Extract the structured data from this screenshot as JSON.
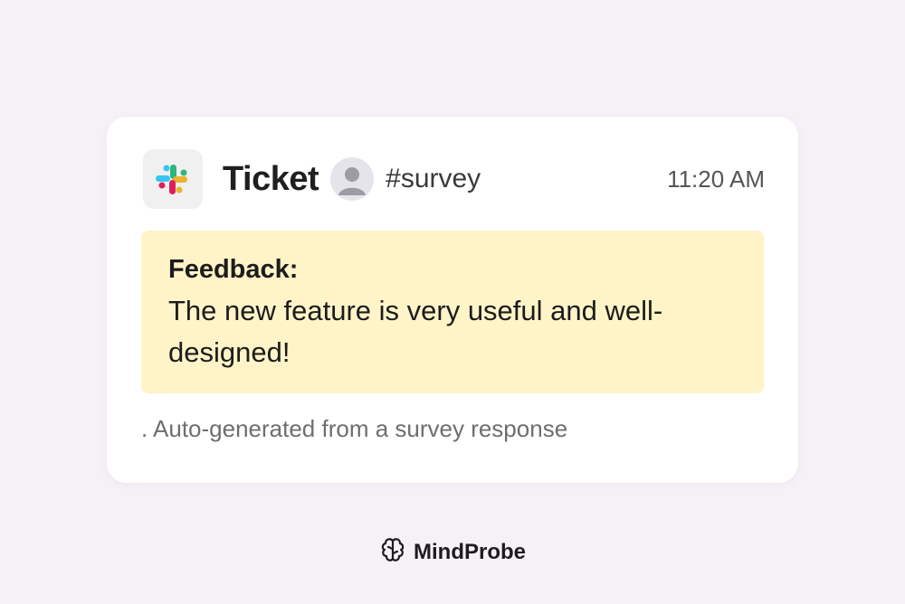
{
  "card": {
    "app_icon": "slack-logo-icon",
    "title": "Ticket",
    "avatar_icon": "user-avatar-icon",
    "channel": "#survey",
    "time": "11:20 AM",
    "feedback": {
      "label": "Feedback:",
      "text": "The new feature is very useful and well-designed!"
    },
    "footnote": ". Auto-generated from a survey response"
  },
  "brand": {
    "icon": "brain-icon",
    "name": "MindProbe"
  },
  "colors": {
    "background": "#f5f1f7",
    "card": "#ffffff",
    "feedback_highlight": "#fff4c8"
  }
}
